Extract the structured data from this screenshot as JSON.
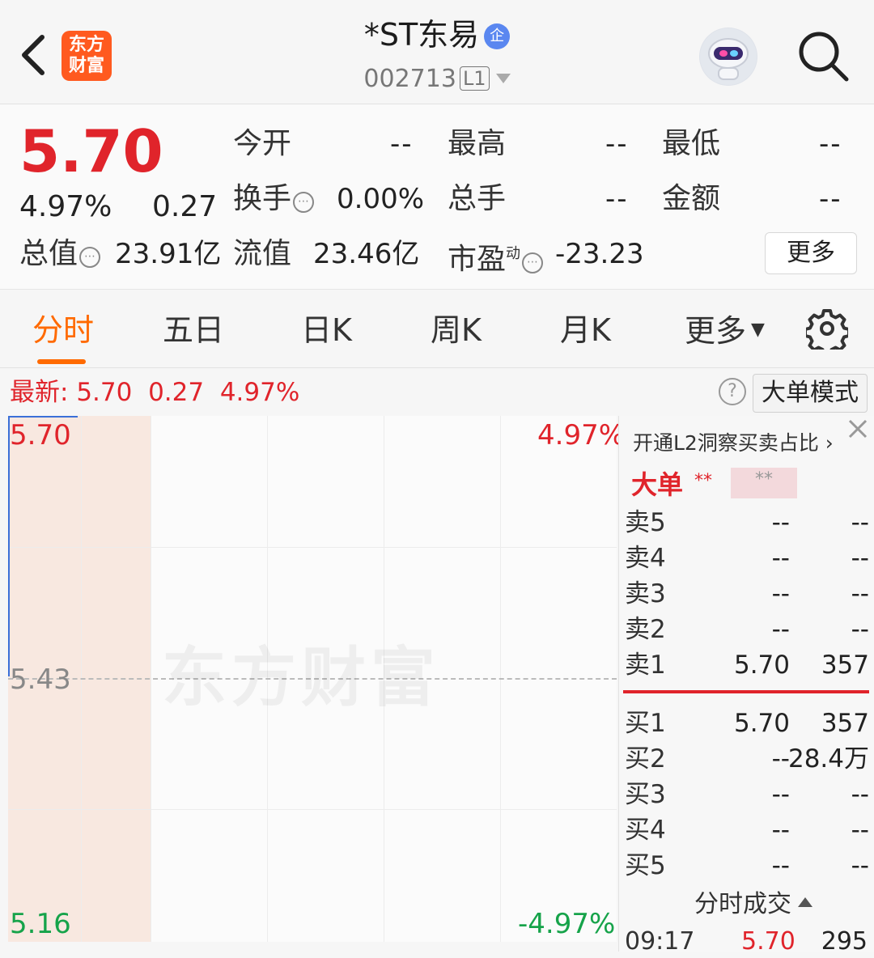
{
  "header": {
    "logo_line1": "东方",
    "logo_line2": "财富",
    "stock_name": "*ST东易",
    "badge": "企",
    "stock_code": "002713",
    "level": "L1"
  },
  "quote": {
    "price": "5.70",
    "change_pct": "4.97%",
    "change": "0.27",
    "open_label": "今开",
    "open_value": "--",
    "high_label": "最高",
    "high_value": "--",
    "low_label": "最低",
    "low_value": "--",
    "turnover_label": "换手",
    "turnover_value": "0.00%",
    "volume_label": "总手",
    "volume_value": "--",
    "amount_label": "金额",
    "amount_value": "--",
    "mktcap_label": "总值",
    "mktcap_value": "23.91亿",
    "float_label": "流值",
    "float_value": "23.46亿",
    "pe_label": "市盈",
    "pe_sup": "动",
    "pe_value": "-23.23",
    "more_button": "更多"
  },
  "tabs": [
    "分时",
    "五日",
    "日K",
    "周K",
    "月K",
    "更多"
  ],
  "latest": {
    "label": "最新:",
    "price": "5.70",
    "change": "0.27",
    "pct": "4.97%",
    "big_order_button": "大单模式"
  },
  "chart": {
    "top_price": "5.70",
    "top_pct": "4.97%",
    "mid_price": "5.43",
    "bottom_price": "5.16",
    "bottom_pct": "-4.97%",
    "watermark": "东方财富"
  },
  "order_book": {
    "l2_promo": "开通L2洞察买卖占比 ›",
    "big_order_label": "大单",
    "stars1": "**",
    "stars2": "**",
    "sells": [
      {
        "name": "卖5",
        "price": "--",
        "vol": "--"
      },
      {
        "name": "卖4",
        "price": "--",
        "vol": "--"
      },
      {
        "name": "卖3",
        "price": "--",
        "vol": "--"
      },
      {
        "name": "卖2",
        "price": "--",
        "vol": "--"
      },
      {
        "name": "卖1",
        "price": "5.70",
        "vol": "357"
      }
    ],
    "buys": [
      {
        "name": "买1",
        "price": "5.70",
        "vol": "357"
      },
      {
        "name": "买2",
        "price": "--",
        "vol": "28.4万"
      },
      {
        "name": "买3",
        "price": "--",
        "vol": "--"
      },
      {
        "name": "买4",
        "price": "--",
        "vol": "--"
      },
      {
        "name": "买5",
        "price": "--",
        "vol": "--"
      }
    ],
    "ticks_title": "分时成交",
    "tick": {
      "time": "09:17",
      "price": "5.70",
      "vol": "295"
    }
  },
  "colors": {
    "up": "#e0242b",
    "down": "#16a34a",
    "accent": "#ff6a00",
    "line": "#3a6fd8"
  }
}
